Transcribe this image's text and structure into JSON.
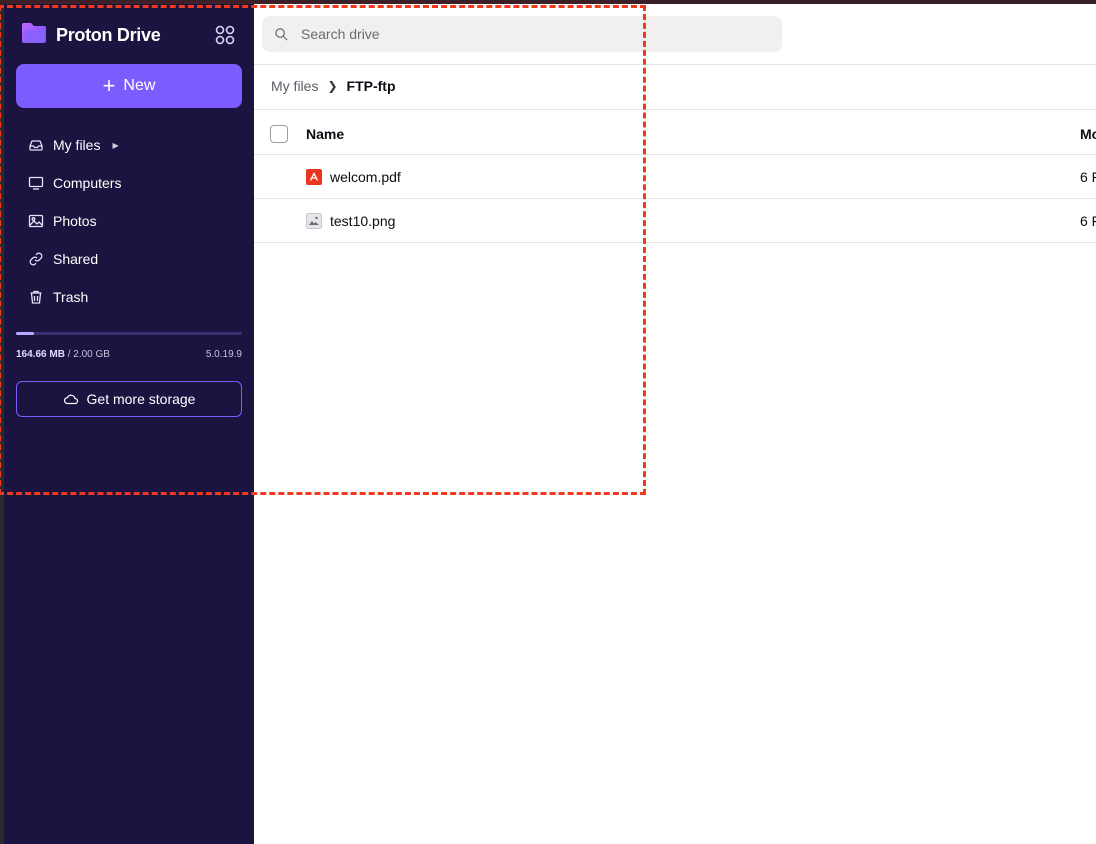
{
  "app": {
    "name": "Proton Drive",
    "accent_color": "#7c5cff",
    "sidebar_color": "#1b1340"
  },
  "sidebar": {
    "new_label": "New",
    "items": [
      {
        "label": "My files",
        "icon": "inbox-icon",
        "has_caret": true
      },
      {
        "label": "Computers",
        "icon": "monitor-icon"
      },
      {
        "label": "Photos",
        "icon": "image-icon"
      },
      {
        "label": "Shared",
        "icon": "link-icon"
      },
      {
        "label": "Trash",
        "icon": "trash-icon"
      }
    ],
    "storage": {
      "used": "164.66 MB",
      "separator": " / ",
      "total": "2.00 GB",
      "used_fraction": 0.08,
      "version": "5.0.19.9"
    },
    "get_more_storage_label": "Get more storage"
  },
  "search": {
    "placeholder": "Search drive"
  },
  "breadcrumb": {
    "root": "My files",
    "current": "FTP-ftp"
  },
  "table": {
    "columns": {
      "name": "Name",
      "modified": "Mo"
    },
    "rows": [
      {
        "name": "welcom.pdf",
        "type_icon": "pdf-icon",
        "modified": "6 F"
      },
      {
        "name": "test10.png",
        "type_icon": "image-file-icon",
        "modified": "6 F"
      }
    ]
  },
  "overlay": {
    "border_color": "#f03a1e"
  }
}
